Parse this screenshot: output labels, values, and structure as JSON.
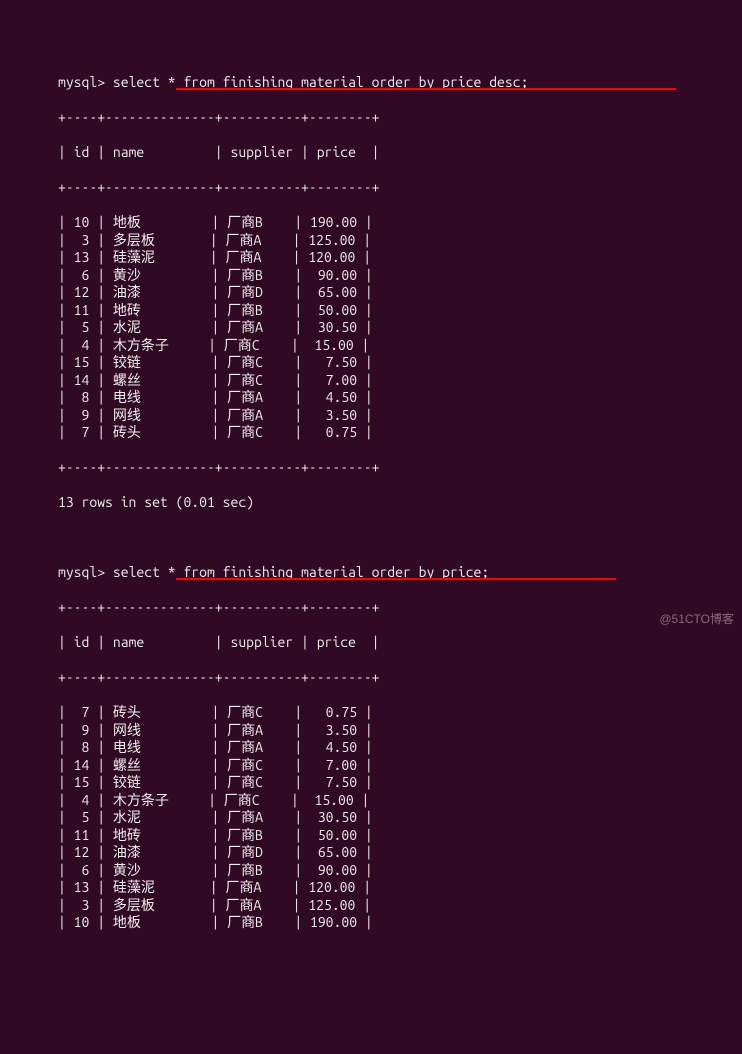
{
  "prompt_prefix": "mysql> ",
  "query1": "select * from finishing_material order by price desc;",
  "query2": "select * from finishing_material order by price;",
  "table_border": "+----+--------------+----------+--------+",
  "header_line": "| id | name         | supplier | price  |",
  "rows1": [
    "| 10 | 地板         | 厂商B    | 190.00 |",
    "|  3 | 多层板       | 厂商A    | 125.00 |",
    "| 13 | 硅藻泥       | 厂商A    | 120.00 |",
    "|  6 | 黄沙         | 厂商B    |  90.00 |",
    "| 12 | 油漆         | 厂商D    |  65.00 |",
    "| 11 | 地砖         | 厂商B    |  50.00 |",
    "|  5 | 水泥         | 厂商A    |  30.50 |",
    "|  4 | 木方条子     | 厂商C    |  15.00 |",
    "| 15 | 铰链         | 厂商C    |   7.50 |",
    "| 14 | 螺丝         | 厂商C    |   7.00 |",
    "|  8 | 电线         | 厂商A    |   4.50 |",
    "|  9 | 网线         | 厂商A    |   3.50 |",
    "|  7 | 砖头         | 厂商C    |   0.75 |"
  ],
  "result_summary": "13 rows in set (0.01 sec)",
  "rows2": [
    "|  7 | 砖头         | 厂商C    |   0.75 |",
    "|  9 | 网线         | 厂商A    |   3.50 |",
    "|  8 | 电线         | 厂商A    |   4.50 |",
    "| 14 | 螺丝         | 厂商C    |   7.00 |",
    "| 15 | 铰链         | 厂商C    |   7.50 |",
    "|  4 | 木方条子     | 厂商C    |  15.00 |",
    "|  5 | 水泥         | 厂商A    |  30.50 |",
    "| 11 | 地砖         | 厂商B    |  50.00 |",
    "| 12 | 油漆         | 厂商D    |  65.00 |",
    "|  6 | 黄沙         | 厂商B    |  90.00 |",
    "| 13 | 硅藻泥       | 厂商A    | 120.00 |",
    "|  3 | 多层板       | 厂商A    | 125.00 |",
    "| 10 | 地板         | 厂商B    | 190.00 |"
  ],
  "watermark": "@51CTO博客",
  "chart_data": {
    "type": "table",
    "title": "finishing_material",
    "columns": [
      "id",
      "name",
      "supplier",
      "price"
    ],
    "rows_desc": [
      {
        "id": 10,
        "name": "地板",
        "supplier": "厂商B",
        "price": 190.0
      },
      {
        "id": 3,
        "name": "多层板",
        "supplier": "厂商A",
        "price": 125.0
      },
      {
        "id": 13,
        "name": "硅藻泥",
        "supplier": "厂商A",
        "price": 120.0
      },
      {
        "id": 6,
        "name": "黄沙",
        "supplier": "厂商B",
        "price": 90.0
      },
      {
        "id": 12,
        "name": "油漆",
        "supplier": "厂商D",
        "price": 65.0
      },
      {
        "id": 11,
        "name": "地砖",
        "supplier": "厂商B",
        "price": 50.0
      },
      {
        "id": 5,
        "name": "水泥",
        "supplier": "厂商A",
        "price": 30.5
      },
      {
        "id": 4,
        "name": "木方条子",
        "supplier": "厂商C",
        "price": 15.0
      },
      {
        "id": 15,
        "name": "铰链",
        "supplier": "厂商C",
        "price": 7.5
      },
      {
        "id": 14,
        "name": "螺丝",
        "supplier": "厂商C",
        "price": 7.0
      },
      {
        "id": 8,
        "name": "电线",
        "supplier": "厂商A",
        "price": 4.5
      },
      {
        "id": 9,
        "name": "网线",
        "supplier": "厂商A",
        "price": 3.5
      },
      {
        "id": 7,
        "name": "砖头",
        "supplier": "厂商C",
        "price": 0.75
      }
    ],
    "rows_asc": [
      {
        "id": 7,
        "name": "砖头",
        "supplier": "厂商C",
        "price": 0.75
      },
      {
        "id": 9,
        "name": "网线",
        "supplier": "厂商A",
        "price": 3.5
      },
      {
        "id": 8,
        "name": "电线",
        "supplier": "厂商A",
        "price": 4.5
      },
      {
        "id": 14,
        "name": "螺丝",
        "supplier": "厂商C",
        "price": 7.0
      },
      {
        "id": 15,
        "name": "铰链",
        "supplier": "厂商C",
        "price": 7.5
      },
      {
        "id": 4,
        "name": "木方条子",
        "supplier": "厂商C",
        "price": 15.0
      },
      {
        "id": 5,
        "name": "水泥",
        "supplier": "厂商A",
        "price": 30.5
      },
      {
        "id": 11,
        "name": "地砖",
        "supplier": "厂商B",
        "price": 50.0
      },
      {
        "id": 12,
        "name": "油漆",
        "supplier": "厂商D",
        "price": 65.0
      },
      {
        "id": 6,
        "name": "黄沙",
        "supplier": "厂商B",
        "price": 90.0
      },
      {
        "id": 13,
        "name": "硅藻泥",
        "supplier": "厂商A",
        "price": 120.0
      },
      {
        "id": 3,
        "name": "多层板",
        "supplier": "厂商A",
        "price": 125.0
      },
      {
        "id": 10,
        "name": "地板",
        "supplier": "厂商B",
        "price": 190.0
      }
    ]
  }
}
